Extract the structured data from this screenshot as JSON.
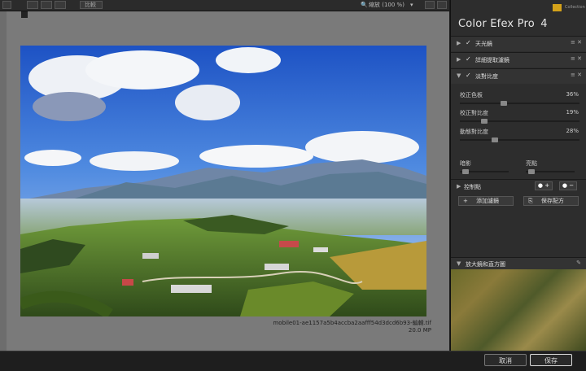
{
  "toolbar": {
    "compare_label": "比較",
    "zoom_label": "縮放 (100 %)",
    "zoom_icon": "magnifier-icon"
  },
  "image": {
    "filename": "mobile01-ae1157a5b4accba2aafff54d3dcd6b93-編輯.tif",
    "megapixels": "20.0 MP"
  },
  "panel": {
    "title": "Color Efex Pro",
    "version": "4",
    "brand_text": "Collection",
    "filters": [
      {
        "label": "天光鏡",
        "enabled": true,
        "expanded": false
      },
      {
        "label": "詳細提取濾鏡",
        "enabled": true,
        "expanded": false
      },
      {
        "label": "淡對比度",
        "enabled": true,
        "expanded": true
      }
    ],
    "sliders": [
      {
        "label": "校正色板",
        "value": "36%",
        "fraction": 0.36
      },
      {
        "label": "校正對比度",
        "value": "19%",
        "fraction": 0.19
      },
      {
        "label": "動態對比度",
        "value": "28%",
        "fraction": 0.28
      }
    ],
    "dark_label": "暗影",
    "light_label": "亮點",
    "dark_fraction": 0.05,
    "light_fraction": 0.05,
    "control_points_label": "控制點",
    "add_filter_label": "添加濾鏡",
    "save_recipe_label": "保存配方",
    "loupe_label": "放大鏡和直方圖"
  },
  "footer": {
    "cancel_label": "取消",
    "save_label": "保存"
  },
  "colors": {
    "accent_red": "#d32020",
    "panel_bg": "#2d2d2d",
    "canvas_bg": "#7a7a7a"
  }
}
